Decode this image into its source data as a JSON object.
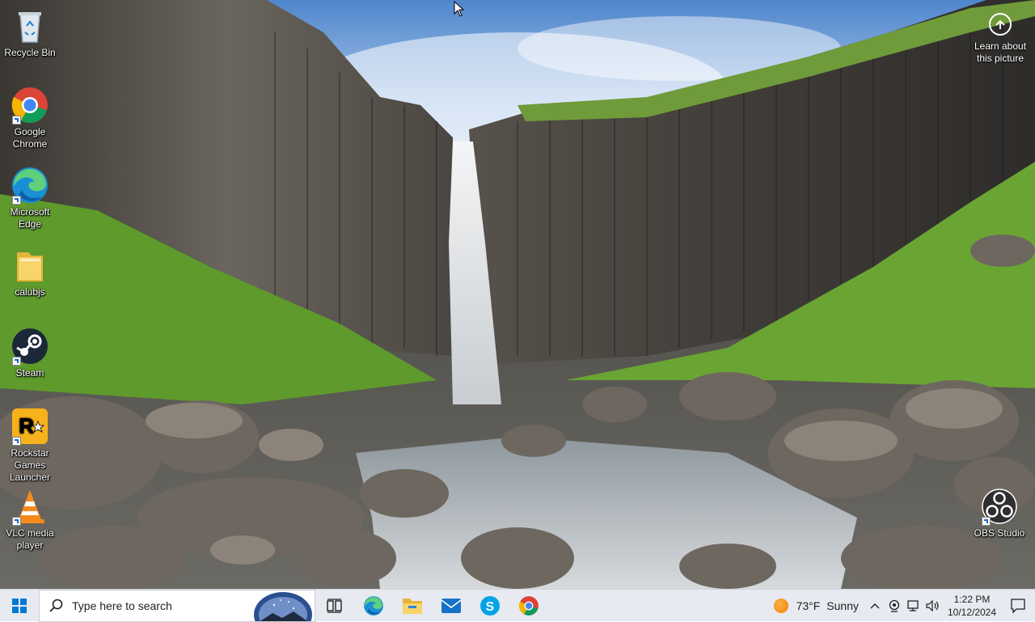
{
  "desktop": {
    "icons": [
      {
        "label": "Recycle Bin"
      },
      {
        "label": "Google Chrome"
      },
      {
        "label": "Microsoft Edge"
      },
      {
        "label": "calubjs"
      },
      {
        "label": "Steam"
      },
      {
        "label": "Rockstar Games Launcher"
      },
      {
        "label": "VLC media player"
      },
      {
        "label": "OBS Studio"
      }
    ],
    "learn_about": "Learn about this picture"
  },
  "taskbar": {
    "search_placeholder": "Type here to search",
    "pinned": [
      "task-view-icon",
      "edge-icon",
      "file-explorer-icon",
      "mail-icon",
      "skype-icon",
      "chrome-icon"
    ],
    "weather": {
      "temp": "73°F",
      "condition": "Sunny"
    },
    "clock": {
      "time": "1:22 PM",
      "date": "10/12/2024"
    }
  },
  "colors": {
    "taskbar_bg": "#e7eaf0",
    "start_blue": "#0078d4"
  }
}
